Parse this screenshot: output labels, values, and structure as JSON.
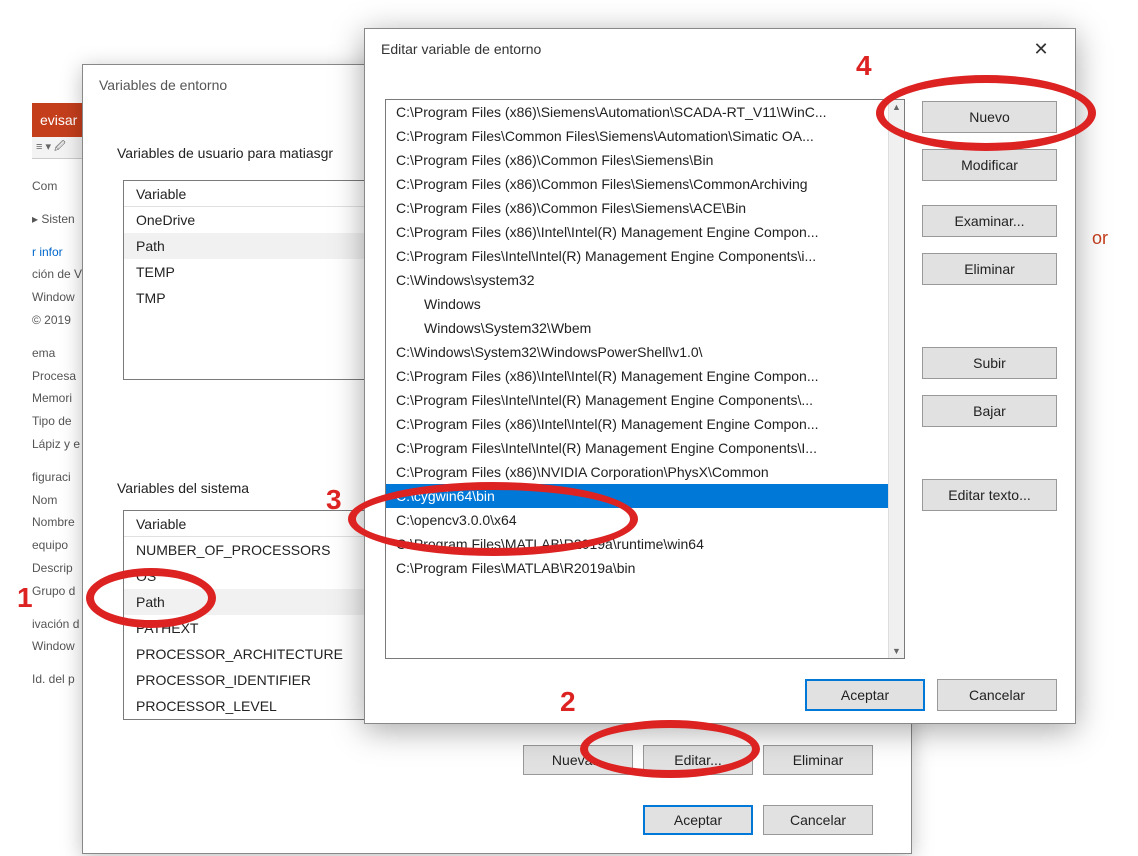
{
  "bg": {
    "ribbon_tab": "evisar",
    "sidebar_labels": {
      "com": "Com",
      "sisten": "Sisten",
      "infor": "r infor",
      "cion_de_v": "ción de V",
      "window": "Window",
      "copyright": "© 2019",
      "ema": "ema",
      "procesa": "Procesa",
      "memori": "Memori",
      "tipo_de": "Tipo de",
      "lapiz_y": "Lápiz y e",
      "figuraci": "figuraci",
      "nom": "Nom",
      "nombre": "Nombre",
      "equipo": "equipo",
      "descrip": "Descrip",
      "grupo": "Grupo d",
      "ivacion": "ivación d",
      "window2": "Window",
      "id_del_p": "Id. del p"
    },
    "right_word": "or"
  },
  "parent": {
    "title": "Variables de entorno",
    "user_group_label": "Variables de usuario para matiasgr",
    "user_vars": {
      "header": "Variable",
      "rows": [
        "OneDrive",
        "Path",
        "TEMP",
        "TMP"
      ]
    },
    "system_group_label": "Variables del sistema",
    "system_vars": {
      "header": "Variable",
      "rows": [
        "NUMBER_OF_PROCESSORS",
        "OS",
        "Path",
        "PATHEXT",
        "PROCESSOR_ARCHITECTURE",
        "PROCESSOR_IDENTIFIER",
        "PROCESSOR_LEVEL"
      ]
    },
    "buttons": {
      "nueva": "Nueva...",
      "editar": "Editar...",
      "eliminar": "Eliminar",
      "aceptar": "Aceptar",
      "cancelar": "Cancelar"
    }
  },
  "child": {
    "title": "Editar variable de entorno",
    "paths": [
      "C:\\Program Files (x86)\\Siemens\\Automation\\SCADA-RT_V11\\WinC...",
      "C:\\Program Files\\Common Files\\Siemens\\Automation\\Simatic OA...",
      "C:\\Program Files (x86)\\Common Files\\Siemens\\Bin",
      "C:\\Program Files (x86)\\Common Files\\Siemens\\CommonArchiving",
      "C:\\Program Files (x86)\\Common Files\\Siemens\\ACE\\Bin",
      "C:\\Program Files (x86)\\Intel\\Intel(R) Management Engine Compon...",
      "C:\\Program Files\\Intel\\Intel(R) Management Engine Components\\i...",
      "C:\\Windows\\system32",
      "Windows",
      "Windows\\System32\\Wbem",
      "C:\\Windows\\System32\\WindowsPowerShell\\v1.0\\",
      "C:\\Program Files (x86)\\Intel\\Intel(R) Management Engine Compon...",
      "C:\\Program Files\\Intel\\Intel(R) Management Engine Components\\...",
      "C:\\Program Files (x86)\\Intel\\Intel(R) Management Engine Compon...",
      "C:\\Program Files\\Intel\\Intel(R) Management Engine Components\\I...",
      "C:\\Program Files (x86)\\NVIDIA Corporation\\PhysX\\Common",
      "C:\\cygwin64\\bin",
      "C:\\opencv3.0.0\\x64",
      "C:\\Program Files\\MATLAB\\R2019a\\runtime\\win64",
      "C:\\Program Files\\MATLAB\\R2019a\\bin"
    ],
    "indent_rows": [
      8,
      9
    ],
    "selected_index": 16,
    "buttons": {
      "nuevo": "Nuevo",
      "modificar": "Modificar",
      "examinar": "Examinar...",
      "eliminar": "Eliminar",
      "subir": "Subir",
      "bajar": "Bajar",
      "editar_texto": "Editar texto...",
      "aceptar": "Aceptar",
      "cancelar": "Cancelar"
    }
  },
  "annotations": {
    "n1": "1",
    "n2": "2",
    "n3": "3",
    "n4": "4"
  }
}
